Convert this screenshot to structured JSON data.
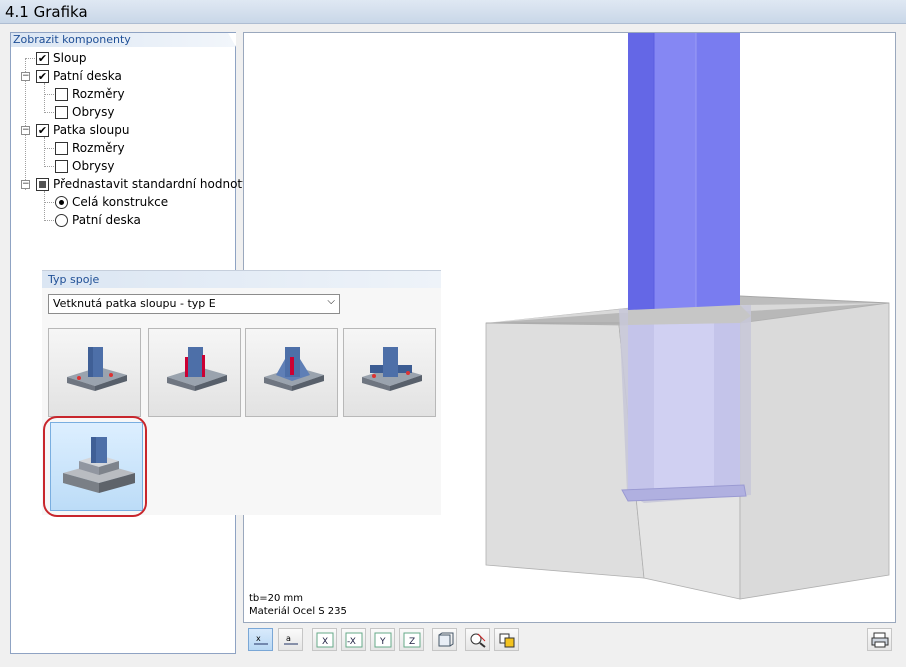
{
  "window": {
    "title": "4.1 Grafika"
  },
  "tree": {
    "header": "Zobrazit komponenty",
    "items": [
      {
        "label": "Sloup",
        "state": "checked"
      },
      {
        "label": "Patní deska",
        "state": "checked"
      },
      {
        "label": "Rozměry",
        "state": "unchecked"
      },
      {
        "label": "Obrysy",
        "state": "unchecked"
      },
      {
        "label": "Patka sloupu",
        "state": "checked"
      },
      {
        "label": "Rozměry",
        "state": "unchecked"
      },
      {
        "label": "Obrysy",
        "state": "unchecked"
      },
      {
        "label": "Přednastavit standardní hodnoty",
        "state": "indeterminate"
      },
      {
        "label": "Celá konstrukce",
        "state": "radio-on"
      },
      {
        "label": "Patní deska",
        "state": "radio-off"
      }
    ]
  },
  "joint": {
    "header": "Typ spoje",
    "selected_value": "Vetknutá patka sloupu - typ E",
    "types": [
      "type-a",
      "type-b",
      "type-c",
      "type-d",
      "type-e"
    ],
    "selected_type": "type-e"
  },
  "viewport": {
    "info_thickness": "tb=20 mm",
    "info_material": "Materiál Ocel S 235"
  },
  "toolbar": {
    "buttons": [
      "show-values-icon",
      "show-labels-icon",
      "view-x-icon",
      "view-neg-x-icon",
      "view-y-icon",
      "view-z-icon",
      "iso-view-icon",
      "zoom-reset-icon",
      "rotate-icon",
      "print-icon"
    ]
  },
  "colors": {
    "column": "#6f72f0",
    "accent": "#1f4f96",
    "selection": "#c8262c"
  }
}
